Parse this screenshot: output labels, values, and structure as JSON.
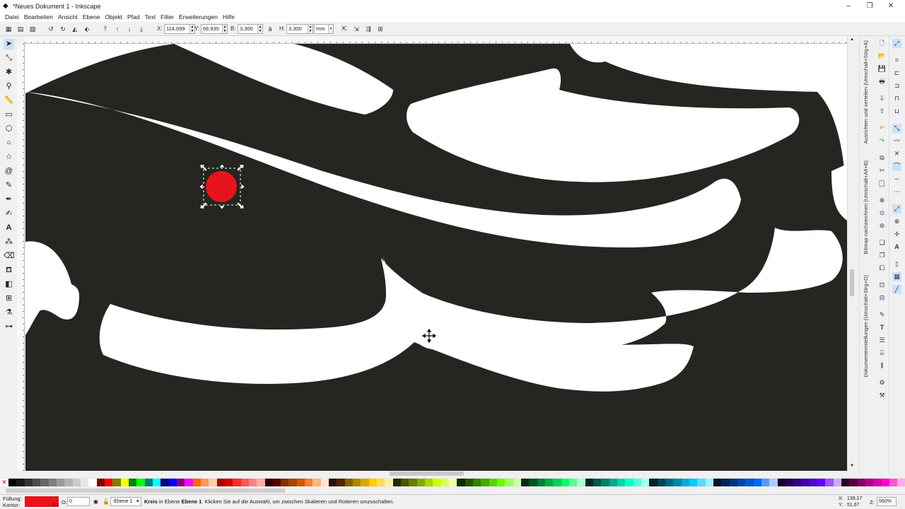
{
  "window": {
    "title": "*Neues Dokument 1 - Inkscape"
  },
  "menu": [
    "Datei",
    "Bearbeiten",
    "Ansicht",
    "Ebene",
    "Objekt",
    "Pfad",
    "Text",
    "Filter",
    "Erweiterungen",
    "Hilfe"
  ],
  "toolbar": {
    "x_label": "X:",
    "x_value": "114,099",
    "y_label": "Y:",
    "y_value": "66,935",
    "w_label": "B:",
    "w_value": "3,300",
    "h_label": "H:",
    "h_value": "3,300",
    "unit": "mm"
  },
  "dialogs": {
    "align": "Ausrichten und verteilen (Umschalt+Strg+A)",
    "trace": "Bitmap nachzeichnen (Umschalt+Alt+B)",
    "docprops": "Dokumenteinstellungen (Umschalt+Strg+D)"
  },
  "status": {
    "fill_label": "Füllung:",
    "stroke_label": "Kontur:",
    "stroke_width": "0,1",
    "opacity_label": "O:",
    "opacity_value": "0",
    "layer": "-Ebene 1",
    "message_bold": "Kreis",
    "message_mid": "in Ebene",
    "message_layer": "Ebene 1",
    "message_rest": ". Klicken Sie auf die Auswahl, um zwischen Skalieren und Rotieren umzuschalten.",
    "cursor_x_label": "X:",
    "cursor_x": "139,17",
    "cursor_y_label": "Y:",
    "cursor_y": "51,67",
    "zoom_label": "Z:",
    "zoom": "560%"
  },
  "colors": {
    "fill": "#e8141c",
    "canvas_art": "#252522",
    "selection": "#e8141c"
  },
  "palette": [
    "#000000",
    "#1a1a1a",
    "#333333",
    "#4d4d4d",
    "#666666",
    "#808080",
    "#999999",
    "#b3b3b3",
    "#cccccc",
    "#e6e6e6",
    "#ffffff",
    "#800000",
    "#ff0000",
    "#808000",
    "#ffff00",
    "#008000",
    "#00ff00",
    "#008080",
    "#00ffff",
    "#000080",
    "#0000ff",
    "#800080",
    "#ff00ff",
    "#ff6600",
    "#ff9955",
    "#ffccaa",
    "#aa0000",
    "#d40000",
    "#ff2a2a",
    "#ff5555",
    "#ff8080",
    "#ffaaaa",
    "#2b0000",
    "#550000",
    "#803300",
    "#aa4400",
    "#d45500",
    "#ff7f2a",
    "#ffb380",
    "#ffe6d5",
    "#2b1100",
    "#552200",
    "#806600",
    "#aa8800",
    "#d4aa00",
    "#ffcc00",
    "#ffdd55",
    "#ffeeaa",
    "#222b00",
    "#445500",
    "#668000",
    "#88aa00",
    "#aad400",
    "#ccff00",
    "#ddff55",
    "#eeffaa",
    "#112b00",
    "#225500",
    "#338000",
    "#44aa00",
    "#55d400",
    "#66ff00",
    "#99ff55",
    "#ccffaa",
    "#002b11",
    "#005522",
    "#008033",
    "#00aa44",
    "#00d455",
    "#00ff66",
    "#55ff99",
    "#aaffcc",
    "#002b22",
    "#005544",
    "#008066",
    "#00aa88",
    "#00d4aa",
    "#00ffcc",
    "#55ffdd",
    "#aaffee",
    "#00222b",
    "#004455",
    "#006680",
    "#0088aa",
    "#00aad4",
    "#00ccff",
    "#55ddff",
    "#aaeeff",
    "#00112b",
    "#002255",
    "#003380",
    "#0044aa",
    "#0055d4",
    "#0066ff",
    "#5599ff",
    "#aaccff",
    "#11002b",
    "#220055",
    "#330080",
    "#4400aa",
    "#5500d4",
    "#6600ff",
    "#9955ff",
    "#ccaaff",
    "#2b0022",
    "#550044",
    "#800066",
    "#aa0088",
    "#d400aa",
    "#ff00cc",
    "#ff55dd",
    "#ffaaee"
  ]
}
